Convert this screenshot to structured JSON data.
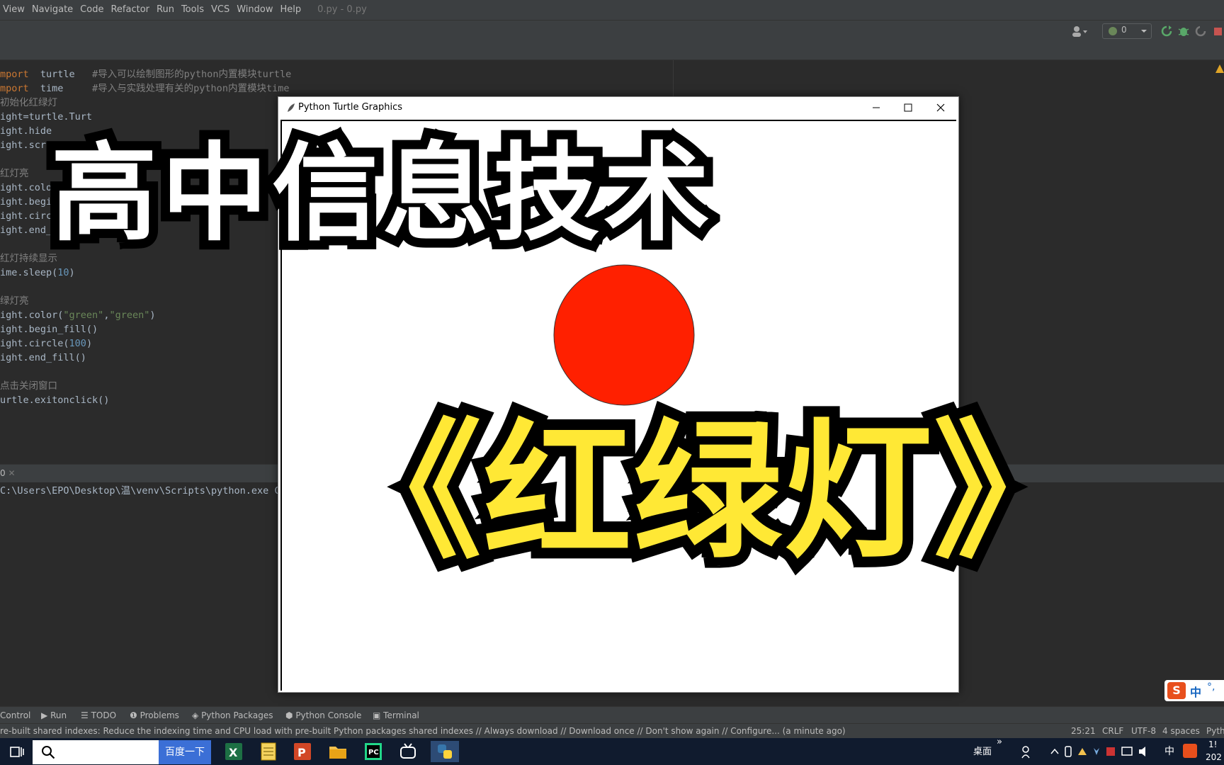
{
  "menu": {
    "items": [
      "View",
      "Navigate",
      "Code",
      "Refactor",
      "Run",
      "Tools",
      "VCS",
      "Window",
      "Help"
    ],
    "file_title": "0.py - 0.py"
  },
  "toolbar": {
    "counter": "0"
  },
  "editor": {
    "lines": [
      {
        "parts": [
          [
            "kw",
            "mport"
          ],
          [
            "",
            "  turtle   "
          ],
          [
            "cm",
            "#导入可以绘制图形的python内置模块turtle"
          ]
        ]
      },
      {
        "parts": [
          [
            "kw",
            "mport"
          ],
          [
            "",
            "  time     "
          ],
          [
            "cm",
            "#导入与实践处理有关的python内置模块time"
          ]
        ]
      },
      {
        "parts": [
          [
            "cm",
            "初始化红绿灯"
          ]
        ]
      },
      {
        "parts": [
          [
            "",
            "ight=turtle.Turt"
          ]
        ]
      },
      {
        "parts": [
          [
            "",
            "ight.hide"
          ]
        ]
      },
      {
        "parts": [
          [
            "",
            "ight.scre"
          ]
        ]
      },
      {
        "parts": [
          [
            "",
            ""
          ]
        ]
      },
      {
        "parts": [
          [
            "cm",
            "红灯亮"
          ]
        ]
      },
      {
        "parts": [
          [
            "",
            "ight.color"
          ]
        ]
      },
      {
        "parts": [
          [
            "",
            "ight.begin"
          ]
        ]
      },
      {
        "parts": [
          [
            "",
            "ight.circl"
          ]
        ]
      },
      {
        "parts": [
          [
            "",
            "ight.end_f"
          ]
        ]
      },
      {
        "parts": [
          [
            "",
            ""
          ]
        ]
      },
      {
        "parts": [
          [
            "cm",
            "红灯持续显示"
          ]
        ]
      },
      {
        "parts": [
          [
            "",
            "ime.sleep("
          ],
          [
            "num",
            "10"
          ],
          [
            "",
            ")"
          ]
        ]
      },
      {
        "parts": [
          [
            "",
            ""
          ]
        ]
      },
      {
        "parts": [
          [
            "cm",
            "绿灯亮"
          ]
        ]
      },
      {
        "parts": [
          [
            "",
            "ight.color("
          ],
          [
            "str",
            "\"green\""
          ],
          [
            "",
            ","
          ],
          [
            "str",
            "\"green\""
          ],
          [
            "",
            ")"
          ]
        ]
      },
      {
        "parts": [
          [
            "",
            "ight.begin_fill()"
          ]
        ]
      },
      {
        "parts": [
          [
            "",
            "ight.circle("
          ],
          [
            "num",
            "100"
          ],
          [
            "",
            ")"
          ]
        ]
      },
      {
        "parts": [
          [
            "",
            "ight.end_fill()"
          ]
        ]
      },
      {
        "parts": [
          [
            "",
            ""
          ]
        ]
      },
      {
        "parts": [
          [
            "cm",
            "点击关闭窗口"
          ]
        ]
      },
      {
        "parts": [
          [
            "",
            "urtle.exitonclick()"
          ]
        ]
      }
    ]
  },
  "run": {
    "tab_label": "0",
    "command": "C:\\Users\\EPO\\Desktop\\温\\venv\\Scripts\\python.exe C:"
  },
  "toolstrip": {
    "items": [
      "Control",
      "Run",
      "TODO",
      "Problems",
      "Python Packages",
      "Python Console",
      "Terminal"
    ]
  },
  "status": {
    "message": "re-built shared indexes: Reduce the indexing time and CPU load with pre-built Python packages shared indexes // Always download // Download once // Don't show again // Configure... (a minute ago)",
    "position": "25:21",
    "line_sep": "CRLF",
    "encoding": "UTF-8",
    "indent": "4 spaces",
    "interpreter": "Pyth"
  },
  "taskbar": {
    "search_button": "百度一下",
    "desktop_label": "桌面",
    "ime_label": "中",
    "clock_time": "1!",
    "clock_date": "202"
  },
  "turtle_window": {
    "title": "Python Turtle Graphics",
    "circle_color": "#ff2000"
  },
  "overlay": {
    "top_title": "高中信息技术",
    "bottom_title": "《红绿灯》"
  },
  "ime": {
    "label": "中"
  }
}
